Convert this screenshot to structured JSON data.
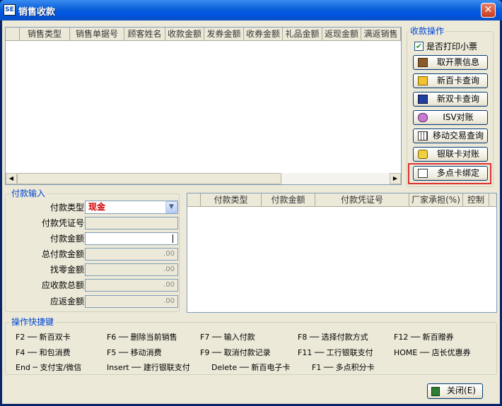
{
  "window": {
    "title": "销售收款",
    "icon_text": "SE"
  },
  "sales_table": {
    "columns": [
      "销售类型",
      "销售单据号",
      "顾客姓名",
      "收款金额",
      "发券金额",
      "收券金额",
      "礼品金额",
      "返现金额",
      "满返销售"
    ]
  },
  "sales_ops": {
    "title": "收款操作",
    "print_receipt_label": "是否打印小票",
    "print_receipt_checked": true,
    "buttons": [
      {
        "label": "取开票信息",
        "icon": "door-exit-icon"
      },
      {
        "label": "新百卡查询",
        "icon": "copy-windows-icon"
      },
      {
        "label": "新双卡查询",
        "icon": "card-reader-icon"
      },
      {
        "label": "ISV对账",
        "icon": "people-icon"
      },
      {
        "label": "移动交易查询",
        "icon": "calculator-grid-icon"
      },
      {
        "label": "银联卡对账",
        "icon": "plug-icon"
      },
      {
        "label": "多点卡绑定",
        "icon": "card-bind-icon"
      }
    ]
  },
  "payment_input": {
    "title": "付款输入",
    "labels": {
      "type": "付款类型",
      "voucher": "付款凭证号",
      "amount": "付款金额",
      "total_paid": "总付款金额",
      "change": "找零金额",
      "receivable": "应收款总额",
      "refund": "应返金额"
    },
    "type_value": "现金",
    "amount_value": "",
    "total_paid_value": ".00",
    "change_value": ".00",
    "receivable_value": ".00",
    "refund_value": ".00"
  },
  "payment_table": {
    "columns": [
      "付款类型",
      "付款金额",
      "付款凭证号",
      "厂家承担(%)",
      "控制"
    ]
  },
  "shortcuts": {
    "title": "操作快捷键",
    "items": [
      {
        "key": "F2",
        "action": "新百双卡"
      },
      {
        "key": "F6",
        "action": "删除当前销售"
      },
      {
        "key": "F7",
        "action": "输入付款"
      },
      {
        "key": "F8",
        "action": "选择付款方式"
      },
      {
        "key": "F12",
        "action": "新百赠券"
      },
      {
        "key": "F4",
        "action": "和包消费"
      },
      {
        "key": "F5",
        "action": "移动消费"
      },
      {
        "key": "F9",
        "action": "取消付款记录"
      },
      {
        "key": "F11",
        "action": "工行银联支付"
      },
      {
        "key": "HOME",
        "action": "店长优惠券"
      },
      {
        "key": "End",
        "action": "支付宝/微信"
      },
      {
        "key": "Insert",
        "action": "建行银联支付"
      },
      {
        "key": "Delete",
        "action": "新百电子卡"
      },
      {
        "key": "F1",
        "action": "多点积分卡"
      }
    ]
  },
  "close_button": {
    "label": "关闭(E)"
  },
  "colors": {
    "highlight_border": "#e03030",
    "type_value": "#d00000",
    "group_title": "#0046d5"
  }
}
